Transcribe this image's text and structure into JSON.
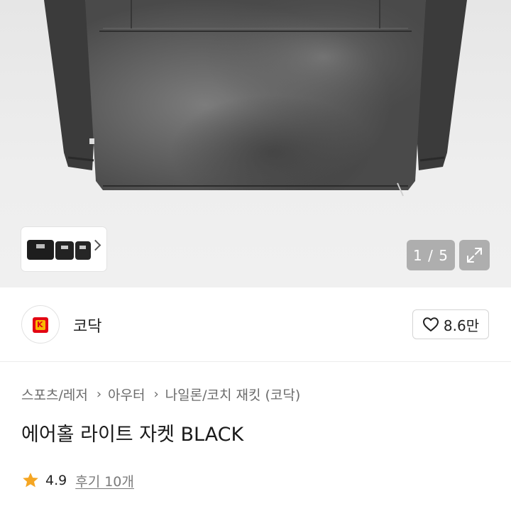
{
  "gallery": {
    "counter": "1 / 5",
    "thumbnail_count": 3
  },
  "store": {
    "name": "코닥",
    "like_count": "8.6만"
  },
  "breadcrumb": [
    "스포츠/레저",
    "아우터",
    "나일론/코치 재킷 (코닥)"
  ],
  "product": {
    "title": "에어홀 라이트 자켓 BLACK"
  },
  "rating": {
    "score": "4.9",
    "reviews_label": "후기 10개"
  },
  "colors": {
    "star": "#f5a623",
    "brand_red": "#e30613",
    "brand_yellow": "#f9b800"
  }
}
